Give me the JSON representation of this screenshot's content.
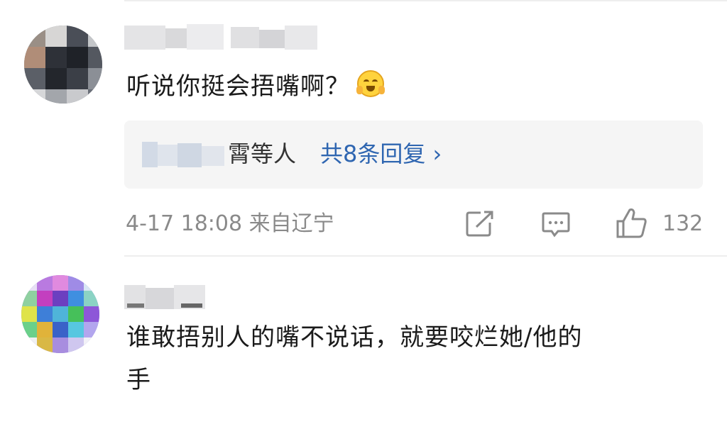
{
  "comments": [
    {
      "text": "听说你挺会捂嘴啊？",
      "emoji": "face-with-hand-over-mouth",
      "replies": {
        "names_suffix": "霄等人",
        "count_label": "共8条回复 ›"
      },
      "meta": "4-17 18:08 来自辽宁",
      "like_count": "132"
    },
    {
      "text_line1": "谁敢捂别人的嘴不说话，就要咬烂她/他的",
      "text_line2": "手"
    }
  ],
  "colors": {
    "link": "#2f66b1",
    "meta": "#8a8a8a",
    "reply_bg": "#f5f5f5"
  },
  "icons": [
    "share-icon",
    "comment-icon",
    "like-icon"
  ]
}
